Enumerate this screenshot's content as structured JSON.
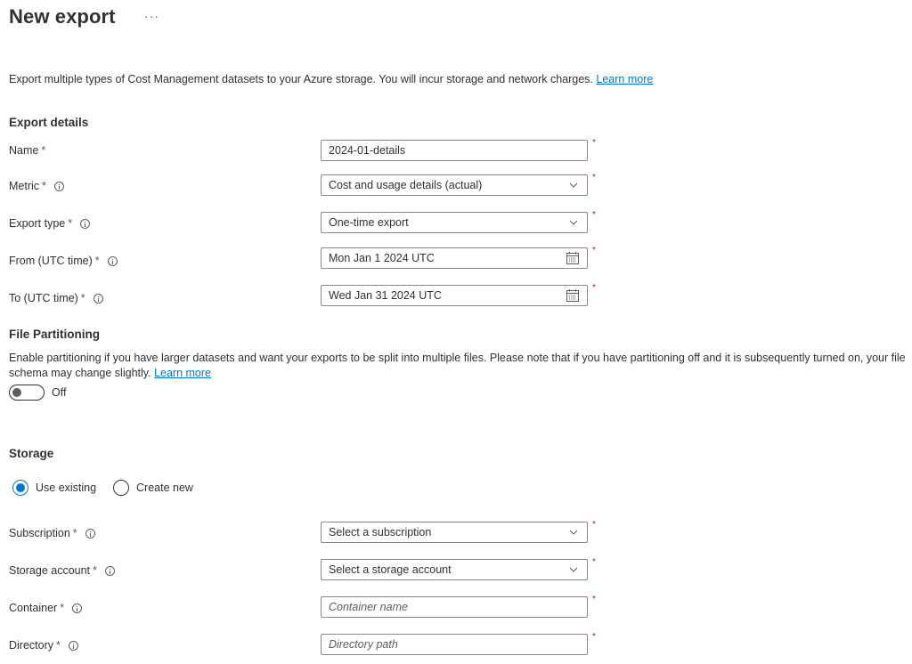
{
  "header": {
    "title": "New export",
    "more_label": "···"
  },
  "description": {
    "text": "Export multiple types of Cost Management datasets to your Azure storage. You will incur storage and network charges.",
    "link": "Learn more"
  },
  "export_details": {
    "heading": "Export details",
    "fields": {
      "name": {
        "label": "Name",
        "required": "*",
        "value": "2024-01-details"
      },
      "metric": {
        "label": "Metric",
        "required": "*",
        "value": "Cost and usage details (actual)"
      },
      "export_type": {
        "label": "Export type",
        "required": "*",
        "value": "One-time export"
      },
      "from": {
        "label": "From (UTC time)",
        "required": "*",
        "value": "Mon Jan 1 2024 UTC"
      },
      "to": {
        "label": "To (UTC time)",
        "required": "*",
        "value": "Wed Jan 31 2024 UTC"
      }
    }
  },
  "file_partitioning": {
    "heading": "File Partitioning",
    "text": "Enable partitioning if you have larger datasets and want your exports to be split into multiple files. Please note that if you have partitioning off and it is subsequently turned on, your file schema may change slightly.",
    "link": "Learn more",
    "toggle_state": "Off"
  },
  "storage": {
    "heading": "Storage",
    "options": [
      {
        "label": "Use existing",
        "checked": true
      },
      {
        "label": "Create new",
        "checked": false
      }
    ],
    "fields": {
      "subscription": {
        "label": "Subscription",
        "required": "*",
        "placeholder": "Select a subscription"
      },
      "storage_account": {
        "label": "Storage account",
        "required": "*",
        "placeholder": "Select a storage account"
      },
      "container": {
        "label": "Container",
        "required": "*",
        "placeholder": "Container name"
      },
      "directory": {
        "label": "Directory",
        "required": "*",
        "placeholder": "Directory path"
      }
    }
  },
  "required_marker": "*",
  "colors": {
    "accent": "#0078d4",
    "text": "#323130",
    "border": "#8a8886",
    "required": "#a4262c"
  }
}
